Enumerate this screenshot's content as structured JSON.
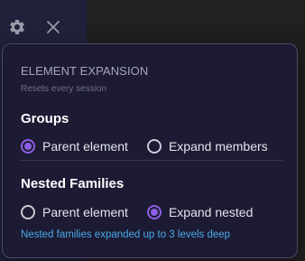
{
  "toolbar": {
    "settings_icon": "gear-icon",
    "close_icon": "close-icon"
  },
  "popover": {
    "section_title": "ELEMENT EXPANSION",
    "section_subtitle": "Resets every session",
    "groups": {
      "heading": "Groups",
      "options": [
        {
          "label": "Parent element",
          "checked": true
        },
        {
          "label": "Expand members",
          "checked": false
        }
      ]
    },
    "nested_families": {
      "heading": "Nested Families",
      "options": [
        {
          "label": "Parent element",
          "checked": false
        },
        {
          "label": "Expand nested",
          "checked": true
        }
      ]
    },
    "info_note": "Nested families expanded up to 3 levels deep"
  },
  "colors": {
    "accent": "#8e5fe6",
    "info": "#4aa8e8",
    "popover_bg": "#1c1b33"
  }
}
